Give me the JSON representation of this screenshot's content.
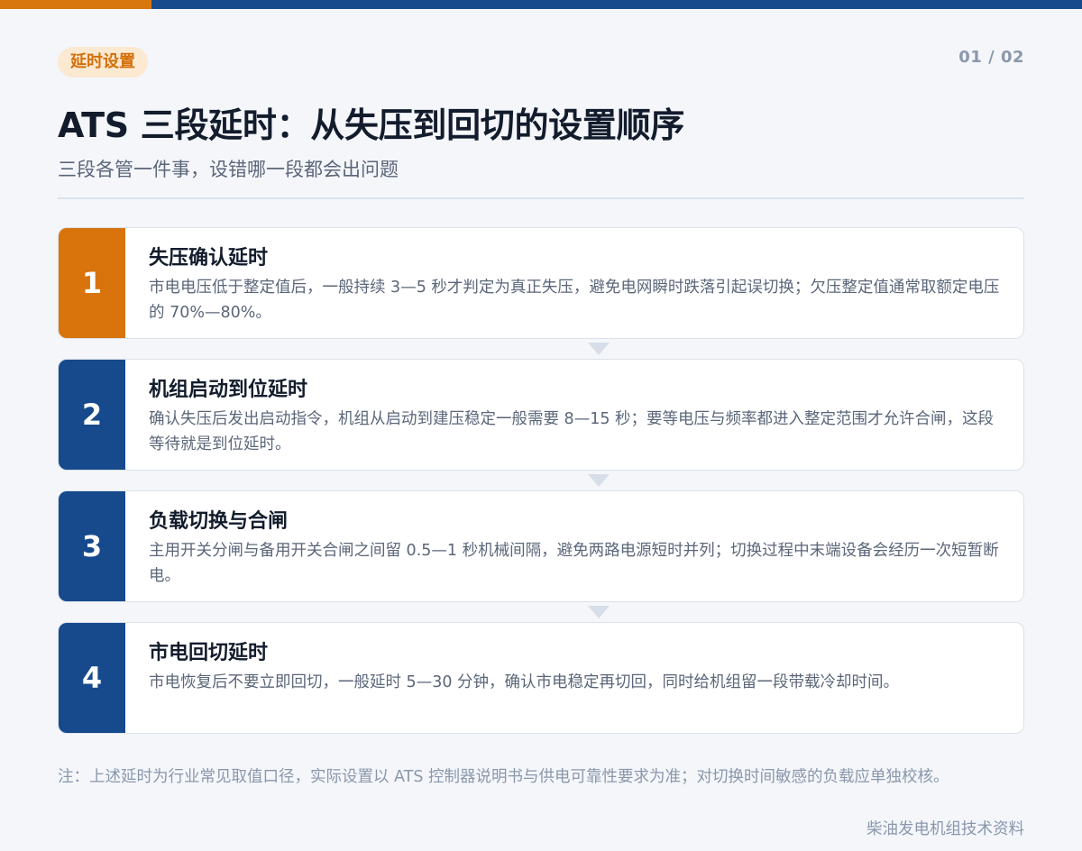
{
  "header": {
    "tag": "延时设置",
    "page_indicator": "01 / 02",
    "title": "ATS 三段延时：从失压到回切的设置顺序",
    "subtitle": "三段各管一件事，设错哪一段都会出问题"
  },
  "colors": {
    "brand_blue": "#164a8c",
    "accent_orange": "#d9770f"
  },
  "steps": [
    {
      "number": "1",
      "title": "失压确认延时",
      "description": "市电电压低于整定值后，一般持续 3—5 秒才判定为真正失压，避免电网瞬时跌落引起误切换；欠压整定值通常取额定电压的 70%—80%。"
    },
    {
      "number": "2",
      "title": "机组启动到位延时",
      "description": "确认失压后发出启动指令，机组从启动到建压稳定一般需要 8—15 秒；要等电压与频率都进入整定范围才允许合闸，这段等待就是到位延时。"
    },
    {
      "number": "3",
      "title": "负载切换与合闸",
      "description": "主用开关分闸与备用开关合闸之间留 0.5—1 秒机械间隔，避免两路电源短时并列；切换过程中末端设备会经历一次短暂断电。"
    },
    {
      "number": "4",
      "title": "市电回切延时",
      "description": "市电恢复后不要立即回切，一般延时 5—30 分钟，确认市电稳定再切回，同时给机组留一段带载冷却时间。"
    }
  ],
  "footer": {
    "note": "注：上述延时为行业常见取值口径，实际设置以 ATS 控制器说明书与供电可靠性要求为准；对切换时间敏感的负载应单独校核。",
    "source": "柴油发电机组技术资料"
  }
}
